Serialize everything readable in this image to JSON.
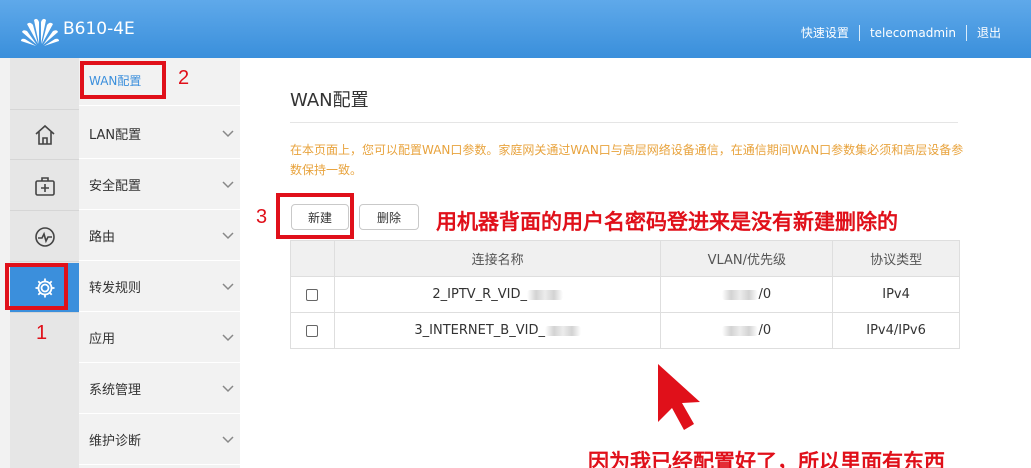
{
  "header": {
    "device_name": "B610-4E",
    "links": {
      "quick_setup": "快速设置",
      "user": "telecomadmin",
      "logout": "退出"
    }
  },
  "iconbar": {
    "items": [
      {
        "icon": "home-icon"
      },
      {
        "icon": "medical-kit-icon"
      },
      {
        "icon": "pulse-icon"
      },
      {
        "icon": "gear-icon",
        "active": true
      }
    ]
  },
  "submenu": {
    "current": "WAN配置",
    "items": [
      "LAN配置",
      "安全配置",
      "路由",
      "转发规则",
      "应用",
      "系统管理",
      "维护诊断"
    ]
  },
  "main": {
    "title": "WAN配置",
    "description": "在本页面上，您可以配置WAN口参数。家庭网关通过WAN口与高层网络设备通信，在通信期间WAN口参数集必须和高层设备参数保持一致。",
    "buttons": {
      "new": "新建",
      "delete": "删除"
    },
    "table": {
      "headers": [
        "连接名称",
        "VLAN/优先级",
        "协议类型"
      ],
      "rows": [
        {
          "name": "2_IPTV_R_VID_",
          "vlan": "/0",
          "protocol": "IPv4"
        },
        {
          "name": "3_INTERNET_B_VID_",
          "vlan": "/0",
          "protocol": "IPv4/IPv6"
        }
      ]
    }
  },
  "annotations": {
    "num1": "1",
    "num2": "2",
    "num3": "3",
    "note_top": "用机器背面的用户名密码登进来是没有新建删除的",
    "note_bottom": "因为我已经配置好了，所以里面有东西"
  },
  "colors": {
    "header_blue": "#3a8fdb",
    "active_blue": "#3b8fdc",
    "annotation_red": "#e0101a",
    "description_orange": "#e8a33d"
  }
}
